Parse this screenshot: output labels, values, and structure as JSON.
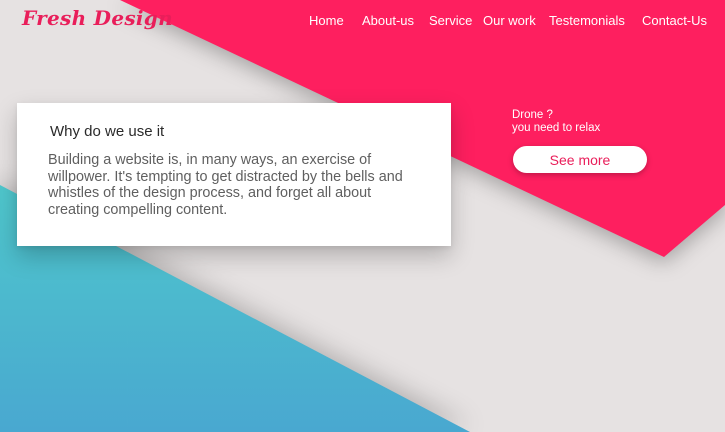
{
  "brand": {
    "logo_text": "Fresh Design"
  },
  "nav": {
    "items": [
      {
        "label": "Home"
      },
      {
        "label": "About-us"
      },
      {
        "label": "Service"
      },
      {
        "label": "Our work"
      },
      {
        "label": "Testemonials"
      },
      {
        "label": "Contact-Us"
      }
    ]
  },
  "card": {
    "title": "Why do we use it",
    "body": "Building a website is, in many ways, an exercise of willpower. It's tempting to get distracted by the bells and whistles of the design process, and forget all about creating compelling content."
  },
  "promo": {
    "line1": "Drone ?",
    "line2": "you need to relax",
    "button_label": "See more"
  },
  "colors": {
    "background": "#e6e2e2",
    "accent_pink": "#fe1f5f",
    "logo_pink": "#e91e5a",
    "teal_top": "#4fc7cc",
    "teal_bottom": "#49a8d0",
    "card_bg": "#ffffff",
    "nav_text": "#ffffff"
  }
}
